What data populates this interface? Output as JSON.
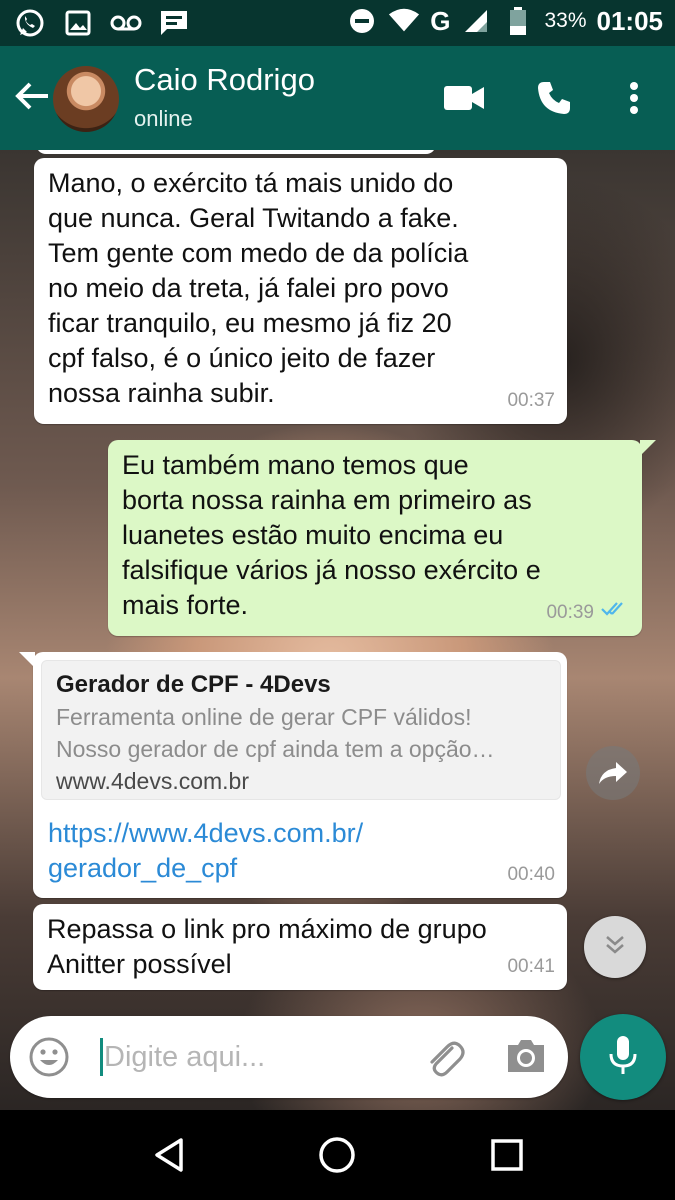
{
  "status_bar": {
    "network": "G",
    "battery": "33%",
    "time": "01:05"
  },
  "header": {
    "contact_name": "Caio Rodrigo",
    "contact_status": "online"
  },
  "messages": [
    {
      "direction": "in",
      "text": "Mano,  o exército tá mais unido do\nque nunca.  Geral Twitando a fake.\nTem gente com medo de da polícia\nno meio da treta,  já falei pro povo\nficar tranquilo,  eu mesmo já fiz 20\ncpf falso, é o único jeito de fazer\nnossa rainha subir.",
      "time": "00:37"
    },
    {
      "direction": "out",
      "text": "Eu também mano temos que\nborta nossa rainha em primeiro as\nluanetes estão muito encima eu\nfalsifique vários já nosso exército e\nmais forte.",
      "time": "00:39",
      "read": true
    },
    {
      "direction": "in",
      "preview": {
        "title": "Gerador de CPF - 4Devs",
        "description_1": "Ferramenta online de gerar CPF válidos!",
        "description_2": "Nosso gerador de cpf ainda tem a opção…",
        "domain": "www.4devs.com.br"
      },
      "link": "https://www.4devs.com.br/\ngerador_de_cpf",
      "time": "00:40"
    },
    {
      "direction": "in",
      "text": "Repassa o link pro máximo de grupo\nAnitter possível",
      "time": "00:41"
    }
  ],
  "composer": {
    "placeholder": "Digite aqui..."
  },
  "colors": {
    "app_bar": "#075e54",
    "status_bar": "#07352f",
    "outgoing_bubble": "#dcf8c6",
    "accent": "#128c7e",
    "link": "#2b8ad6"
  }
}
